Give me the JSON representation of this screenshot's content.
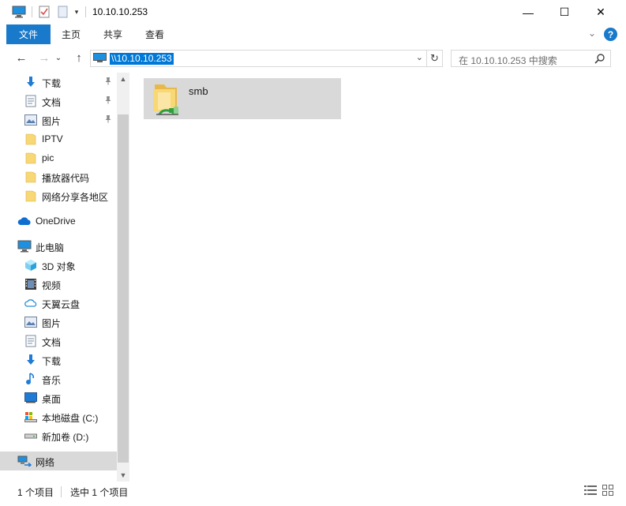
{
  "window": {
    "title": "10.10.10.253",
    "minimize_glyph": "—",
    "maximize_glyph": "☐",
    "close_glyph": "✕"
  },
  "ribbon": {
    "file": "文件",
    "home": "主页",
    "share": "共享",
    "view": "查看",
    "collapse_glyph": "⌄",
    "help_glyph": "?"
  },
  "address": {
    "path": "\\\\10.10.10.253",
    "dropdown_glyph": "⌄",
    "refresh_glyph": "↻",
    "back_glyph": "←",
    "forward_glyph": "→",
    "recent_glyph": "⌄",
    "up_glyph": "↑"
  },
  "search": {
    "placeholder": "在 10.10.10.253 中搜索"
  },
  "nav": {
    "items": [
      {
        "label": "下载",
        "icon": "download-icon",
        "pinned": true
      },
      {
        "label": "文档",
        "icon": "document-icon",
        "pinned": true
      },
      {
        "label": "图片",
        "icon": "picture-icon",
        "pinned": true
      },
      {
        "label": "IPTV",
        "icon": "folder-icon"
      },
      {
        "label": "pic",
        "icon": "folder-icon"
      },
      {
        "label": "播放器代码",
        "icon": "folder-icon"
      },
      {
        "label": "网络分享各地区",
        "icon": "folder-icon"
      },
      {
        "label": "OneDrive",
        "icon": "onedrive-icon"
      },
      {
        "label": "此电脑",
        "icon": "this-pc-icon"
      },
      {
        "label": "3D 对象",
        "icon": "3d-objects-icon"
      },
      {
        "label": "视频",
        "icon": "video-icon"
      },
      {
        "label": "天翼云盘",
        "icon": "cloud-drive-icon"
      },
      {
        "label": "图片",
        "icon": "picture-icon"
      },
      {
        "label": "文档",
        "icon": "document-icon"
      },
      {
        "label": "下载",
        "icon": "download-icon"
      },
      {
        "label": "音乐",
        "icon": "music-icon"
      },
      {
        "label": "桌面",
        "icon": "desktop-icon"
      },
      {
        "label": "本地磁盘 (C:)",
        "icon": "local-disk-icon"
      },
      {
        "label": "新加卷 (D:)",
        "icon": "drive-icon"
      },
      {
        "label": "网络",
        "icon": "network-icon",
        "selected": true
      }
    ],
    "scroll_up_glyph": "▲",
    "scroll_down_glyph": "▼",
    "pin_glyph": "📌"
  },
  "content": {
    "items": [
      {
        "label": "smb",
        "icon": "shared-folder-icon"
      }
    ]
  },
  "status": {
    "item_count": "1 个项目",
    "selected_count": "选中 1 个项目"
  },
  "colors": {
    "accent": "#1979ca",
    "selection": "#0078d7",
    "hover": "#d9d9d9",
    "folder": "#f8d775"
  }
}
